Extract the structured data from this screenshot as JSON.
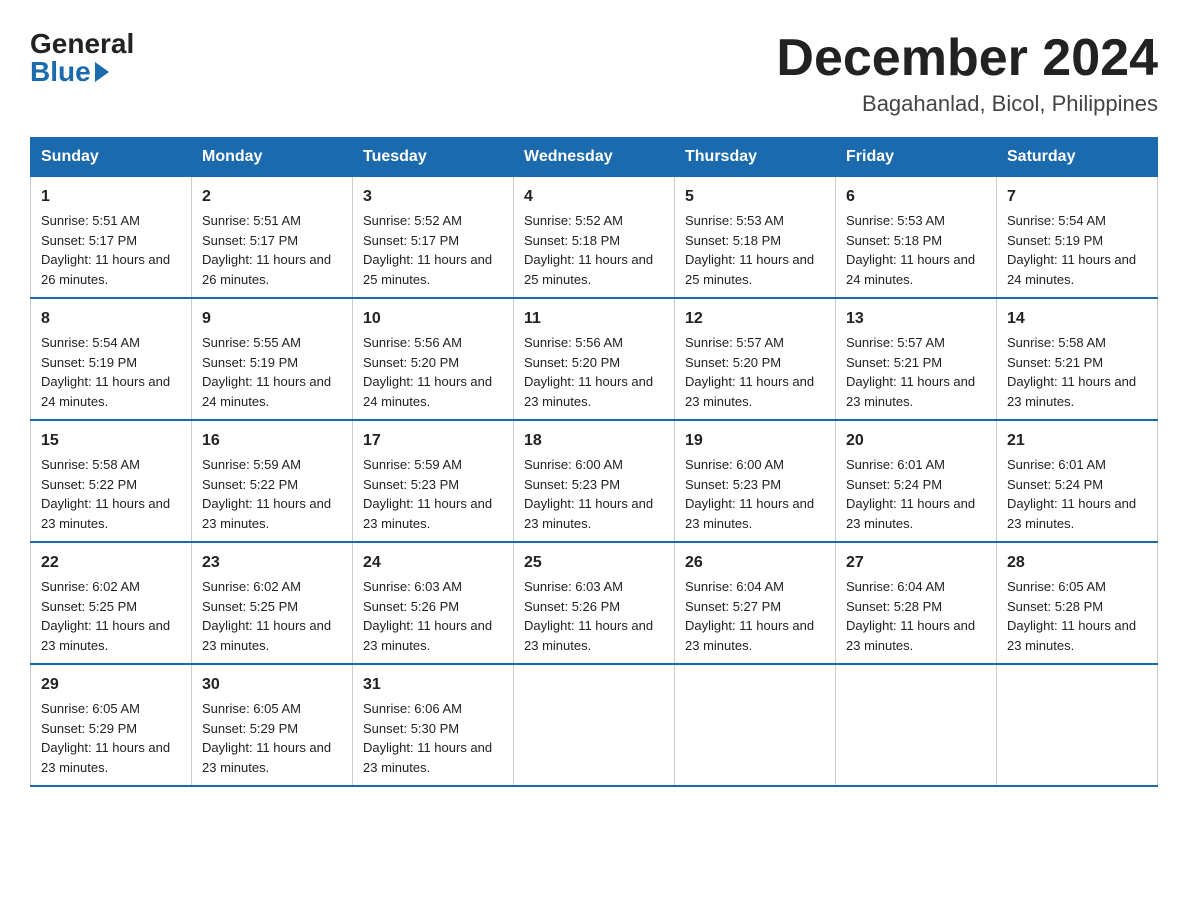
{
  "logo": {
    "general": "General",
    "blue": "Blue"
  },
  "title": "December 2024",
  "subtitle": "Bagahanlad, Bicol, Philippines",
  "weekdays": [
    "Sunday",
    "Monday",
    "Tuesday",
    "Wednesday",
    "Thursday",
    "Friday",
    "Saturday"
  ],
  "weeks": [
    [
      {
        "day": "1",
        "sunrise": "5:51 AM",
        "sunset": "5:17 PM",
        "daylight": "11 hours and 26 minutes."
      },
      {
        "day": "2",
        "sunrise": "5:51 AM",
        "sunset": "5:17 PM",
        "daylight": "11 hours and 26 minutes."
      },
      {
        "day": "3",
        "sunrise": "5:52 AM",
        "sunset": "5:17 PM",
        "daylight": "11 hours and 25 minutes."
      },
      {
        "day": "4",
        "sunrise": "5:52 AM",
        "sunset": "5:18 PM",
        "daylight": "11 hours and 25 minutes."
      },
      {
        "day": "5",
        "sunrise": "5:53 AM",
        "sunset": "5:18 PM",
        "daylight": "11 hours and 25 minutes."
      },
      {
        "day": "6",
        "sunrise": "5:53 AM",
        "sunset": "5:18 PM",
        "daylight": "11 hours and 24 minutes."
      },
      {
        "day": "7",
        "sunrise": "5:54 AM",
        "sunset": "5:19 PM",
        "daylight": "11 hours and 24 minutes."
      }
    ],
    [
      {
        "day": "8",
        "sunrise": "5:54 AM",
        "sunset": "5:19 PM",
        "daylight": "11 hours and 24 minutes."
      },
      {
        "day": "9",
        "sunrise": "5:55 AM",
        "sunset": "5:19 PM",
        "daylight": "11 hours and 24 minutes."
      },
      {
        "day": "10",
        "sunrise": "5:56 AM",
        "sunset": "5:20 PM",
        "daylight": "11 hours and 24 minutes."
      },
      {
        "day": "11",
        "sunrise": "5:56 AM",
        "sunset": "5:20 PM",
        "daylight": "11 hours and 23 minutes."
      },
      {
        "day": "12",
        "sunrise": "5:57 AM",
        "sunset": "5:20 PM",
        "daylight": "11 hours and 23 minutes."
      },
      {
        "day": "13",
        "sunrise": "5:57 AM",
        "sunset": "5:21 PM",
        "daylight": "11 hours and 23 minutes."
      },
      {
        "day": "14",
        "sunrise": "5:58 AM",
        "sunset": "5:21 PM",
        "daylight": "11 hours and 23 minutes."
      }
    ],
    [
      {
        "day": "15",
        "sunrise": "5:58 AM",
        "sunset": "5:22 PM",
        "daylight": "11 hours and 23 minutes."
      },
      {
        "day": "16",
        "sunrise": "5:59 AM",
        "sunset": "5:22 PM",
        "daylight": "11 hours and 23 minutes."
      },
      {
        "day": "17",
        "sunrise": "5:59 AM",
        "sunset": "5:23 PM",
        "daylight": "11 hours and 23 minutes."
      },
      {
        "day": "18",
        "sunrise": "6:00 AM",
        "sunset": "5:23 PM",
        "daylight": "11 hours and 23 minutes."
      },
      {
        "day": "19",
        "sunrise": "6:00 AM",
        "sunset": "5:23 PM",
        "daylight": "11 hours and 23 minutes."
      },
      {
        "day": "20",
        "sunrise": "6:01 AM",
        "sunset": "5:24 PM",
        "daylight": "11 hours and 23 minutes."
      },
      {
        "day": "21",
        "sunrise": "6:01 AM",
        "sunset": "5:24 PM",
        "daylight": "11 hours and 23 minutes."
      }
    ],
    [
      {
        "day": "22",
        "sunrise": "6:02 AM",
        "sunset": "5:25 PM",
        "daylight": "11 hours and 23 minutes."
      },
      {
        "day": "23",
        "sunrise": "6:02 AM",
        "sunset": "5:25 PM",
        "daylight": "11 hours and 23 minutes."
      },
      {
        "day": "24",
        "sunrise": "6:03 AM",
        "sunset": "5:26 PM",
        "daylight": "11 hours and 23 minutes."
      },
      {
        "day": "25",
        "sunrise": "6:03 AM",
        "sunset": "5:26 PM",
        "daylight": "11 hours and 23 minutes."
      },
      {
        "day": "26",
        "sunrise": "6:04 AM",
        "sunset": "5:27 PM",
        "daylight": "11 hours and 23 minutes."
      },
      {
        "day": "27",
        "sunrise": "6:04 AM",
        "sunset": "5:28 PM",
        "daylight": "11 hours and 23 minutes."
      },
      {
        "day": "28",
        "sunrise": "6:05 AM",
        "sunset": "5:28 PM",
        "daylight": "11 hours and 23 minutes."
      }
    ],
    [
      {
        "day": "29",
        "sunrise": "6:05 AM",
        "sunset": "5:29 PM",
        "daylight": "11 hours and 23 minutes."
      },
      {
        "day": "30",
        "sunrise": "6:05 AM",
        "sunset": "5:29 PM",
        "daylight": "11 hours and 23 minutes."
      },
      {
        "day": "31",
        "sunrise": "6:06 AM",
        "sunset": "5:30 PM",
        "daylight": "11 hours and 23 minutes."
      },
      null,
      null,
      null,
      null
    ]
  ],
  "labels": {
    "sunrise": "Sunrise:",
    "sunset": "Sunset:",
    "daylight": "Daylight:"
  }
}
